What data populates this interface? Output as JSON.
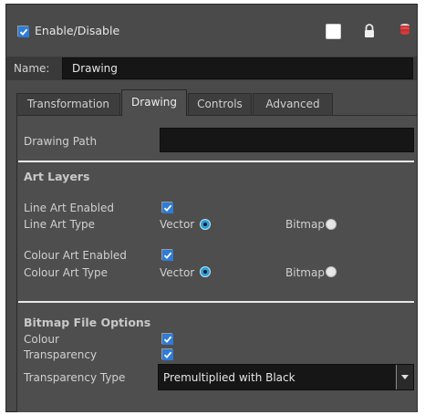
{
  "header": {
    "enable_label": "Enable/Disable",
    "enable_checked": true,
    "icons": [
      "color-swatch-icon",
      "lock-icon",
      "layer-stack-icon"
    ],
    "colors": {
      "swatch": "#ffffff",
      "stack": "#d43a3a"
    }
  },
  "name_row": {
    "label": "Name:",
    "value": "Drawing"
  },
  "tabs": [
    {
      "label": "Transformation",
      "active": false
    },
    {
      "label": "Drawing",
      "active": true
    },
    {
      "label": "Controls",
      "active": false
    },
    {
      "label": "Advanced",
      "active": false
    }
  ],
  "drawing_path": {
    "label": "Drawing Path",
    "value": ""
  },
  "art_layers": {
    "title": "Art Layers",
    "line_art_enabled": {
      "label": "Line Art Enabled",
      "checked": true
    },
    "line_art_type": {
      "label": "Line Art Type",
      "option_vector": "Vector",
      "option_bitmap": "Bitmap",
      "selected": "Vector"
    },
    "colour_art_enabled": {
      "label": "Colour Art Enabled",
      "checked": true
    },
    "colour_art_type": {
      "label": "Colour Art Type",
      "option_vector": "Vector",
      "option_bitmap": "Bitmap",
      "selected": "Vector"
    }
  },
  "bitmap_options": {
    "title": "Bitmap File Options",
    "colour": {
      "label": "Colour",
      "checked": true
    },
    "transparency": {
      "label": "Transparency",
      "checked": true
    },
    "transparency_type": {
      "label": "Transparency Type",
      "value": "Premultiplied with Black"
    }
  }
}
